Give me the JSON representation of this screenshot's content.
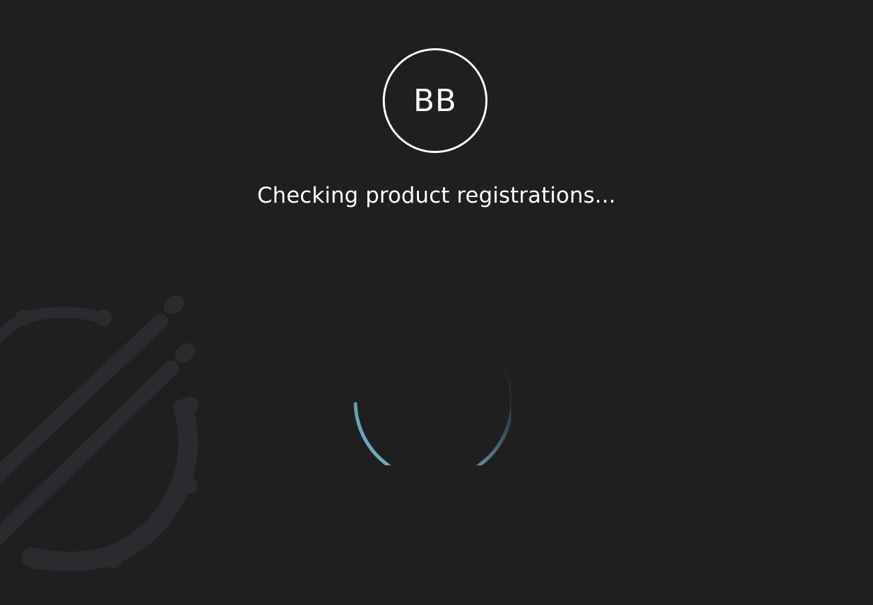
{
  "logo": {
    "text": "BB"
  },
  "status": {
    "message": "Checking product registrations..."
  },
  "spinner": {
    "color": "#7ab8d4",
    "icon": "loading-spinner-icon"
  },
  "background": {
    "icon": "drum-and-sticks-icon",
    "color": "#2a2b2f"
  },
  "theme": {
    "background": "#1f1f1f",
    "text": "#ffffff"
  }
}
